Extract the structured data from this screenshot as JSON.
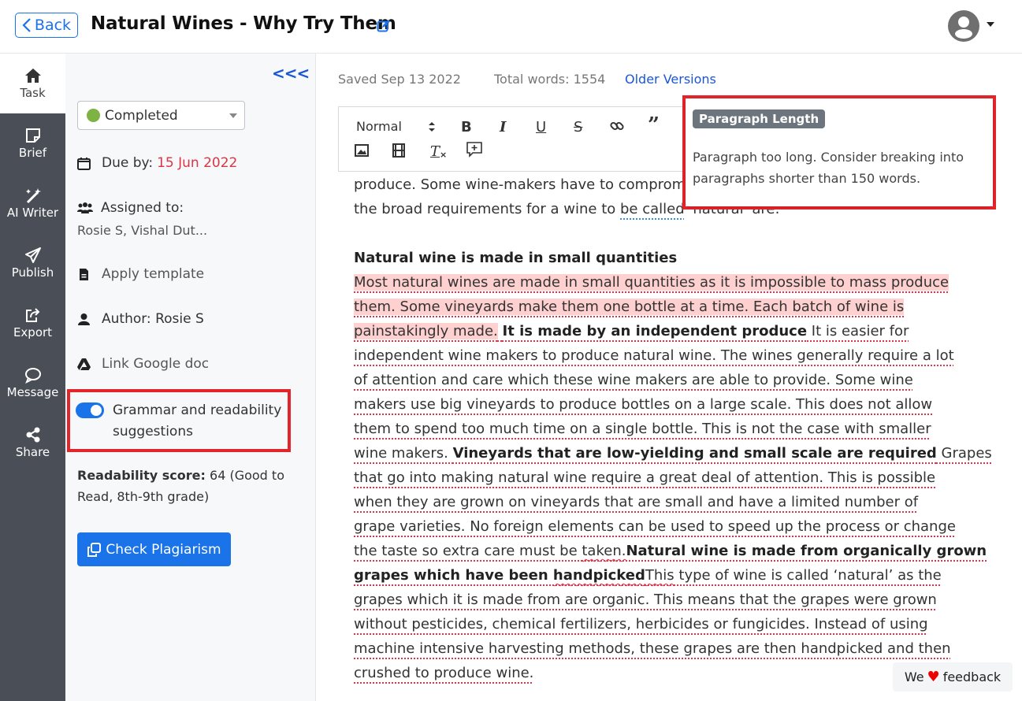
{
  "header": {
    "back_label": "Back",
    "title": "Natural Wines - Why Try Them"
  },
  "nav": [
    {
      "label": "Task",
      "icon": "home-icon",
      "active": true
    },
    {
      "label": "Brief",
      "icon": "sticky-note-icon"
    },
    {
      "label": "AI Writer",
      "icon": "magic-wand-icon"
    },
    {
      "label": "Publish",
      "icon": "paper-plane-icon"
    },
    {
      "label": "Export",
      "icon": "share-square-icon"
    },
    {
      "label": "Message",
      "icon": "speech-bubble-icon"
    },
    {
      "label": "Share",
      "icon": "share-nodes-icon"
    }
  ],
  "panel": {
    "collapse_label": "<<<",
    "status": "Completed",
    "status_color": "#7cb342",
    "due_label": "Due by:",
    "due_date": "15 Jun 2022",
    "assigned_label": "Assigned to:",
    "assignees": "Rosie S, Vishal Dut...",
    "apply_template": "Apply template",
    "author": "Author: Rosie S",
    "link_google_doc": "Link Google doc",
    "grammar_toggle_label": "Grammar and readability suggestions",
    "grammar_toggle_on": true,
    "readability_label": "Readability score:",
    "readability_value": "64 (Good to Read, 8th-9th grade)",
    "check_plagiarism": "Check Plagiarism"
  },
  "editor_meta": {
    "saved": "Saved Sep 13 2022",
    "total_words": "Total words: 1554",
    "older_versions": "Older Versions"
  },
  "toolbar": {
    "format_select": "Normal"
  },
  "popover": {
    "badge": "Paragraph Length",
    "text": "Paragraph too long. Consider breaking into paragraphs shorter than 150 words."
  },
  "content": {
    "l1": "produce. Some wine-makers have to comprom",
    "l2a": "the broad requirements for a wine to ",
    "l2b": "be called",
    "l2c": " 'natural' are:",
    "heading": "Natural wine is made in small quantities",
    "p1": "Most natural wines are made in small quantities as it is impossible to mass produce",
    "p2": "them. Some vineyards make them one bottle at a time. Each batch of wine is",
    "p3a": "painstakingly made.",
    "p3b": "It is made by an independent produce",
    "p3c": " It is easier for",
    "p4": "independent wine makers to produce natural wine. The wines generally require a lot",
    "p5": "of attention and care which these wine makers are able to provide. Some wine",
    "p6": "makers use big vineyards to produce bottles on a large scale. This does not allow",
    "p7": "them to spend too much time on a single bottle. This is not the case with smaller",
    "p8a": "wine makers. ",
    "p8b": "Vineyards that are low-yielding and small scale are required",
    "p8c": " Grapes",
    "p9": "that go into making natural wine require a great deal of attention. This is possible",
    "p10": "when they are grown on vineyards that are small and have a limited number of",
    "p11": "grape varieties. No foreign elements can be used to speed up the process or change",
    "p12a": "the taste so extra care must be ",
    "p12b": "taken.",
    "p12c": "Natural wine is made from organically grown",
    "p13a": "grapes which have been ",
    "p13b": "handpicked",
    "p13c": "This",
    "p13d": " type of wine is called ‘natural’ as the",
    "p14": "grapes which it is made from are organic. This means that the grapes were grown",
    "p15": "without pesticides, chemical fertilizers, herbicides or fungicides. Instead of using",
    "p16": "machine intensive harvesting methods, these grapes are then handpicked and then",
    "p17": "crushed to produce wine."
  },
  "feedback": {
    "pre": "We",
    "post": "feedback"
  }
}
